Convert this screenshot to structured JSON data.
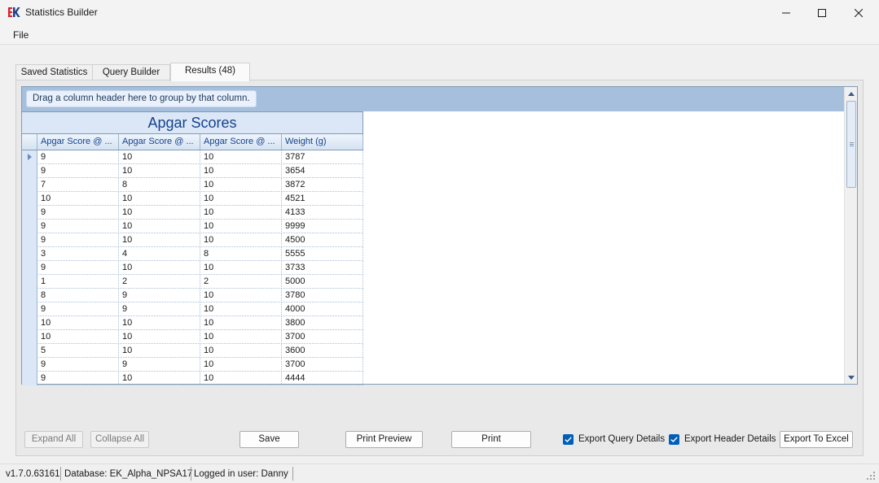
{
  "window": {
    "title": "Statistics Builder"
  },
  "menu": {
    "file_label": "File"
  },
  "tabs": [
    {
      "label": "Saved Statistics"
    },
    {
      "label": "Query Builder"
    },
    {
      "label": "Results (48)"
    }
  ],
  "grid": {
    "group_hint": "Drag a column header here to group by that column.",
    "band_title": "Apgar Scores",
    "columns": [
      "Apgar Score @ ...",
      "Apgar Score @ ...",
      "Apgar Score @ ...",
      "Weight (g)"
    ],
    "rows": [
      [
        "9",
        "10",
        "10",
        "3787"
      ],
      [
        "9",
        "10",
        "10",
        "3654"
      ],
      [
        "7",
        "8",
        "10",
        "3872"
      ],
      [
        "10",
        "10",
        "10",
        "4521"
      ],
      [
        "9",
        "10",
        "10",
        "4133"
      ],
      [
        "9",
        "10",
        "10",
        "9999"
      ],
      [
        "9",
        "10",
        "10",
        "4500"
      ],
      [
        "3",
        "4",
        "8",
        "5555"
      ],
      [
        "9",
        "10",
        "10",
        "3733"
      ],
      [
        "1",
        "2",
        "2",
        "5000"
      ],
      [
        "8",
        "9",
        "10",
        "3780"
      ],
      [
        "9",
        "9",
        "10",
        "4000"
      ],
      [
        "10",
        "10",
        "10",
        "3800"
      ],
      [
        "10",
        "10",
        "10",
        "3700"
      ],
      [
        "5",
        "10",
        "10",
        "3600"
      ],
      [
        "9",
        "9",
        "10",
        "3700"
      ],
      [
        "9",
        "10",
        "10",
        "4444"
      ]
    ]
  },
  "buttons": {
    "expand_all": "Expand All",
    "collapse_all": "Collapse All",
    "save": "Save",
    "print_preview": "Print Preview",
    "print": "Print",
    "export_to_excel": "Export To Excel"
  },
  "checkboxes": {
    "export_query_details": "Export Query Details",
    "export_header_details": "Export Header Details"
  },
  "status": {
    "version": "v1.7.0.63161",
    "database": "Database: EK_Alpha_NPSA17",
    "user": "Logged in user: Danny"
  },
  "colors": {
    "accent": "#005fb8",
    "header_band": "#a5bfdd",
    "title_text": "#15428b",
    "logo_red": "#d9232e",
    "logo_blue": "#1b3f8f"
  },
  "icons": {
    "logo": "ek-logo-icon",
    "minimize": "minimize-icon",
    "maximize": "maximize-icon",
    "close": "close-icon",
    "row_indicator": "row-arrow-icon",
    "scroll_up": "chevron-up-icon",
    "scroll_down": "chevron-down-icon",
    "checkmark": "checkmark-icon",
    "resize_grip": "resize-grip-icon"
  }
}
